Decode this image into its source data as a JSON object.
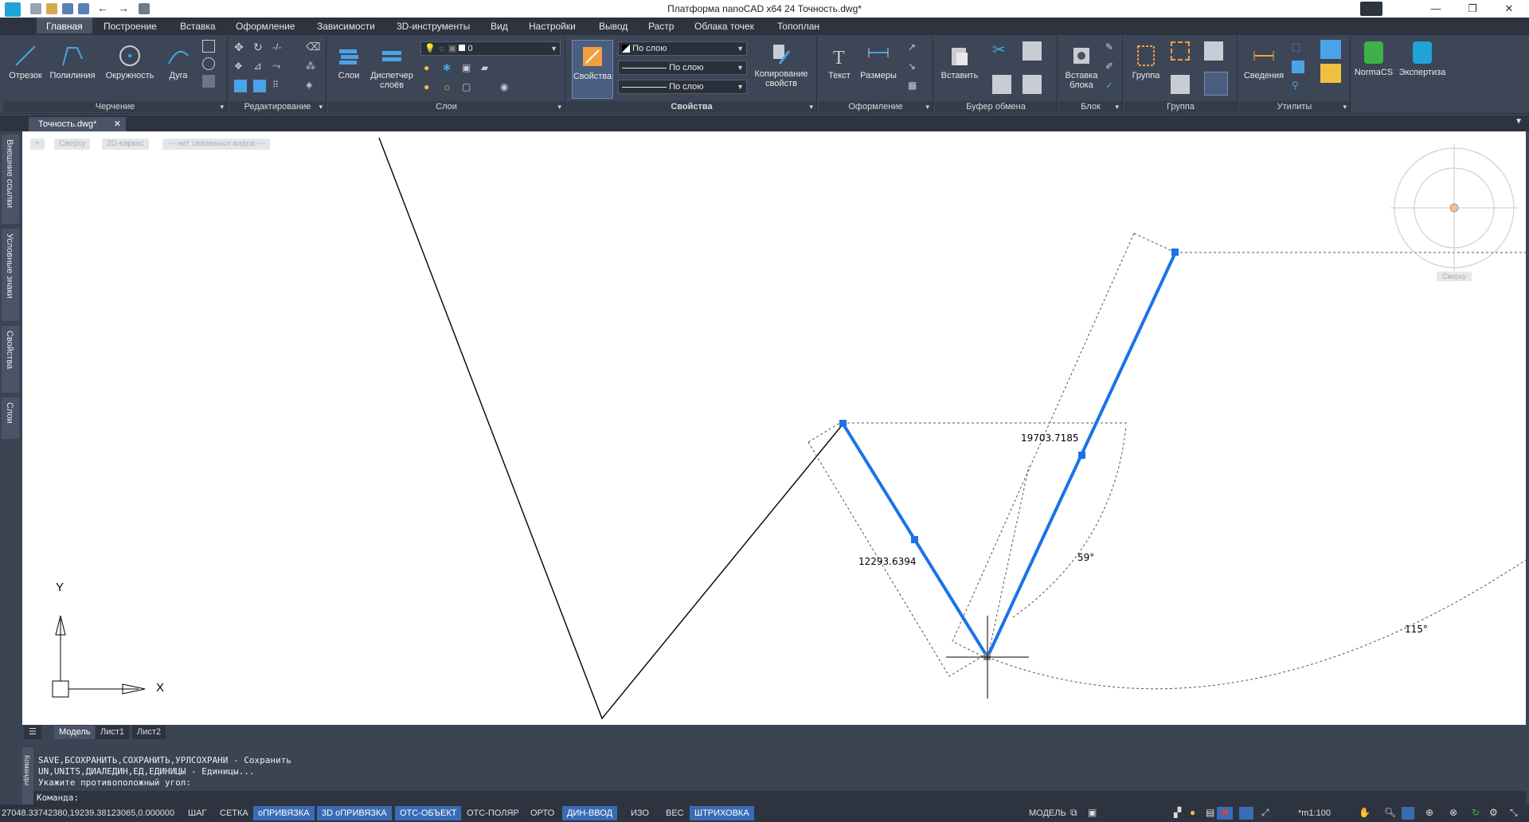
{
  "window": {
    "title": "Платформа nanoCAD x64 24 Точность.dwg*",
    "minimize": "—",
    "maximize": "❐",
    "close": "✕"
  },
  "menu_tabs": [
    "Главная",
    "Построение",
    "Вставка",
    "Оформление",
    "Зависимости",
    "3D-инструменты",
    "Вид",
    "Настройки",
    "Вывод",
    "Растр",
    "Облака точек",
    "Топоплан"
  ],
  "ribbon": {
    "draw": {
      "title": "Черчение",
      "line": "Отрезок",
      "polyline": "Полилиния",
      "circle": "Окружность",
      "arc": "Дуга"
    },
    "edit": {
      "title": "Редактирование"
    },
    "layers": {
      "title": "Слои",
      "layers_btn": "Слои",
      "manager_btn": "Диспетчер слоёв",
      "current_layer": "0"
    },
    "properties": {
      "title": "Свойства",
      "props_btn": "Свойства",
      "color": "По слою",
      "linetype": "По слою",
      "lineweight": "По слою",
      "match_btn": "Копирование свойств"
    },
    "format": {
      "title": "Оформление",
      "text": "Текст",
      "dims": "Размеры"
    },
    "clipboard": {
      "title": "Буфер обмена",
      "paste": "Вставить"
    },
    "block": {
      "title": "Блок",
      "insert": "Вставка блока"
    },
    "group": {
      "title": "Группа",
      "group_btn": "Группа"
    },
    "utils": {
      "title": "Утилиты",
      "info": "Сведения"
    },
    "normacs": "NormaCS",
    "expert": "Экспертиза"
  },
  "doc_tab": "Точность.dwg*",
  "side_tabs": [
    "Внешние ссылки",
    "Условные знаки",
    "Свойства",
    "Слои"
  ],
  "viewport_controls": [
    "+",
    "Сверху",
    "2D-каркас",
    "--- нет связанных видов ---"
  ],
  "viewcube_label": "Сверху",
  "drawing": {
    "dim_length_1": "12293.6394",
    "dim_length_2": "19703.7185",
    "angle_1": "59°",
    "angle_2": "115°",
    "ucs_x": "X",
    "ucs_y": "Y"
  },
  "layout_tabs": [
    "Модель",
    "Лист1",
    "Лист2"
  ],
  "command_lines": [
    "SAVE,БСОХРАНИТЬ,СОХРАНИТЬ,УРЛСОХРАНИ - Сохранить",
    "UN,UNITS,ДИАЛЕДИН,ЕД,ЕДИНИЦЫ - Единицы...",
    "Укажите противоположный угол:"
  ],
  "command_prompt": "Команда:",
  "command_panel_label": "Команды",
  "status": {
    "coords": "27048.33742380,19239.38123065,0.000000",
    "toggles": [
      {
        "label": "ШАГ",
        "on": false
      },
      {
        "label": "СЕТКА",
        "on": false
      },
      {
        "label": "оПРИВЯЗКА",
        "on": true
      },
      {
        "label": "3D оПРИВЯЗКА",
        "on": true
      },
      {
        "label": "ОТС-ОБЪЕКТ",
        "on": true
      },
      {
        "label": "ОТС-ПОЛЯР",
        "on": false
      },
      {
        "label": "ОРТО",
        "on": false
      },
      {
        "label": "ДИН-ВВОД",
        "on": true
      },
      {
        "label": "ИЗО",
        "on": false
      },
      {
        "label": "ВЕС",
        "on": false
      },
      {
        "label": "ШТРИХОВКА",
        "on": true
      }
    ],
    "model": "МОДЕЛЬ",
    "scale": "*m1:100"
  },
  "colors": {
    "accent": "#3a6cb5",
    "selection": "#1a73e8",
    "ribbon": "#3d4656",
    "canvas": "#ffffff"
  }
}
